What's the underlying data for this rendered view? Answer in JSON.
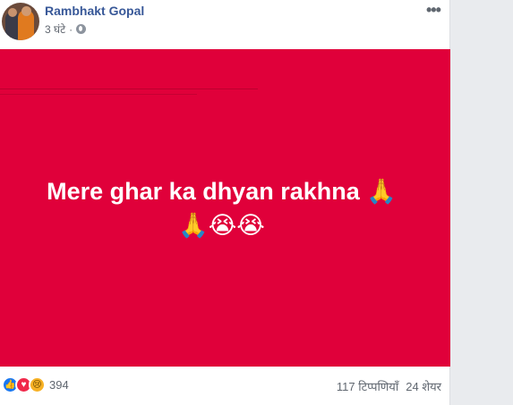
{
  "post": {
    "author": "Rambhakt Gopal",
    "time": "3 घंटे",
    "separator": "·",
    "privacy_icon": "globe-icon",
    "more_icon": "more-options-icon",
    "more_label": "•••",
    "text_line1": "Mere ghar ka dhyan rakhna 🙏",
    "text_line2": "🙏😭😭",
    "background_color": "#e0003a"
  },
  "footer": {
    "reactions": [
      {
        "icon": "like-icon",
        "glyph": "👍"
      },
      {
        "icon": "love-icon",
        "glyph": "♥"
      },
      {
        "icon": "sad-icon",
        "glyph": "😢"
      }
    ],
    "reaction_count": "394",
    "comments": "117 टिप्पणियाँ",
    "shares": "24 शेयर"
  }
}
